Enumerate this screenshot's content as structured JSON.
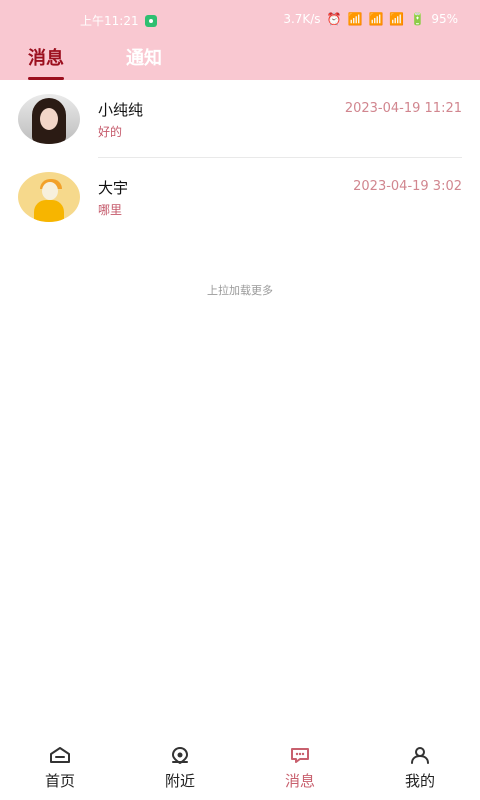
{
  "status_bar": {
    "time": "上午11:21",
    "net_speed": "3.7K/s",
    "battery": "95%"
  },
  "tabs": [
    {
      "label": "消息"
    },
    {
      "label": "通知"
    }
  ],
  "messages": [
    {
      "name": "小纯纯",
      "preview": "好的",
      "time": "2023-04-19 11:21"
    },
    {
      "name": "大宇",
      "preview": "哪里",
      "time": "2023-04-19 3:02"
    }
  ],
  "load_more": "上拉加载更多",
  "bottom_nav": [
    {
      "label": "首页",
      "icon": "home-icon"
    },
    {
      "label": "附近",
      "icon": "location-icon"
    },
    {
      "label": "消息",
      "icon": "chat-icon",
      "active": true
    },
    {
      "label": "我的",
      "icon": "user-icon"
    }
  ],
  "colors": {
    "header_bg": "#f9c8d1",
    "accent": "#9b0f1e",
    "active_nav": "#c8606e"
  }
}
